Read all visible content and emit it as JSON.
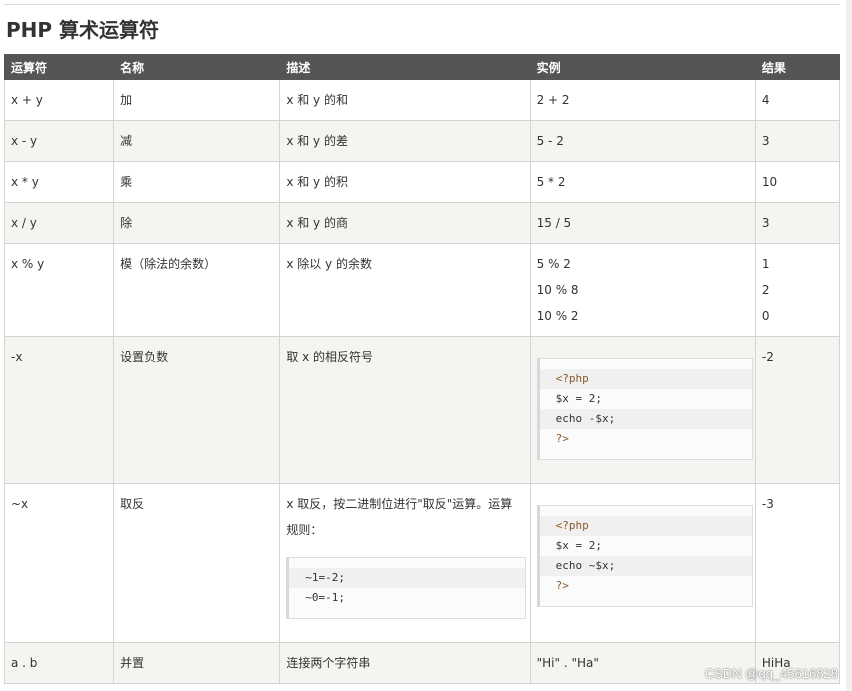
{
  "page": {
    "title": "PHP 算术运算符"
  },
  "table": {
    "headers": [
      "运算符",
      "名称",
      "描述",
      "实例",
      "结果"
    ],
    "rows": [
      {
        "op": "x + y",
        "name": "加",
        "desc": "x 和 y 的和",
        "example": "2 + 2",
        "result": "4"
      },
      {
        "op": "x - y",
        "name": "减",
        "desc": "x 和 y 的差",
        "example": "5 - 2",
        "result": "3"
      },
      {
        "op": "x * y",
        "name": "乘",
        "desc": "x 和 y 的积",
        "example": "5 * 2",
        "result": "10"
      },
      {
        "op": "x / y",
        "name": "除",
        "desc": "x 和 y 的商",
        "example": "15 / 5",
        "result": "3"
      },
      {
        "op": "x % y",
        "name": "模（除法的余数）",
        "desc": "x 除以 y 的余数",
        "examples": [
          "5 % 2",
          "10 % 8",
          "10 % 2"
        ],
        "results": [
          "1",
          "2",
          "0"
        ]
      },
      {
        "op": "-x",
        "name": "设置负数",
        "desc": "取 x 的相反符号",
        "code": [
          "<?php",
          "$x = 2;",
          "echo -$x;",
          "?>"
        ],
        "result": "-2"
      },
      {
        "op": "~x",
        "name": "取反",
        "desc": "x 取反，按二进制位进行\"取反\"运算。运算规则：",
        "desc_code": [
          "~1=-2;",
          "~0=-1;"
        ],
        "code": [
          "<?php",
          "$x = 2;",
          "echo ~$x;",
          "?>"
        ],
        "result": "-3"
      },
      {
        "op": "a . b",
        "name": "并置",
        "desc": "连接两个字符串",
        "example": "\"Hi\" . \"Ha\"",
        "result": "HiHa"
      }
    ]
  },
  "watermark": "CSDN @qq_45616828"
}
